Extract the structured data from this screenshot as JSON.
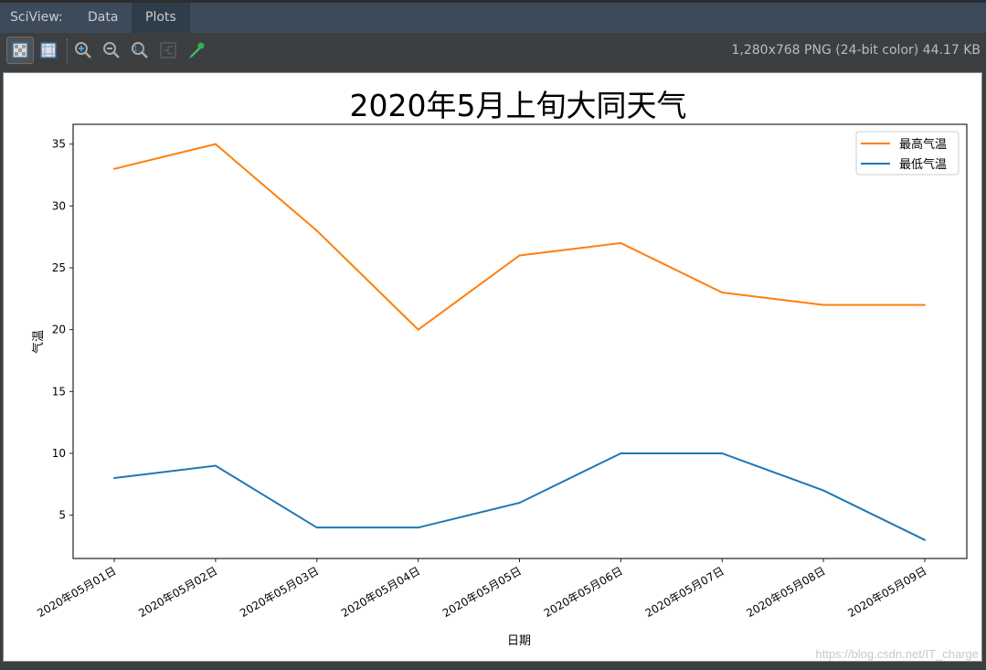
{
  "header": {
    "label": "SciView:",
    "tabs": [
      {
        "label": "Data"
      },
      {
        "label": "Plots"
      }
    ]
  },
  "toolbar": {
    "icons": [
      "checker-background-icon",
      "grid-icon",
      "zoom-in-icon",
      "zoom-out-icon",
      "actual-size-icon",
      "fit-icon",
      "color-picker-icon"
    ],
    "image_info": "1,280x768 PNG (24-bit color) 44.17 KB"
  },
  "watermark": "https://blog.csdn.net/IT_charge",
  "colors": {
    "high": "#ff7f0e",
    "low": "#1f77b4"
  },
  "chart_data": {
    "type": "line",
    "title": "2020年5月上旬大同天气",
    "xlabel": "日期",
    "ylabel": "气温",
    "categories": [
      "2020年05月01日",
      "2020年05月02日",
      "2020年05月03日",
      "2020年05月04日",
      "2020年05月05日",
      "2020年05月06日",
      "2020年05月07日",
      "2020年05月08日",
      "2020年05月09日"
    ],
    "series": [
      {
        "name": "最高气温",
        "values": [
          33,
          35,
          28,
          20,
          26,
          27,
          23,
          22,
          22
        ]
      },
      {
        "name": "最低气温",
        "values": [
          8,
          9,
          4,
          4,
          6,
          10,
          10,
          7,
          3
        ]
      }
    ],
    "yticks": [
      "5",
      "10",
      "15",
      "20",
      "25",
      "30",
      "35"
    ],
    "ylim": [
      1.5,
      36.6
    ],
    "legend": "top-right",
    "grid": false
  }
}
